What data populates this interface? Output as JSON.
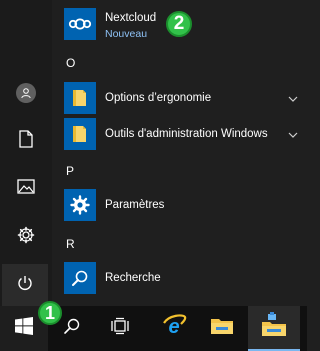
{
  "start_menu": {
    "recent_app": {
      "name": "Nextcloud",
      "subtitle": "Nouveau",
      "icon": "nextcloud-icon"
    },
    "groups": [
      {
        "letter": "O",
        "items": [
          {
            "label": "Options d’ergonomie",
            "icon": "folder-icon",
            "expandable": true
          },
          {
            "label": "Outils d'administration Windows",
            "icon": "folder-icon",
            "expandable": true
          }
        ]
      },
      {
        "letter": "P",
        "items": [
          {
            "label": "Paramètres",
            "icon": "gear-icon",
            "expandable": false
          }
        ]
      },
      {
        "letter": "R",
        "items": [
          {
            "label": "Recherche",
            "icon": "search-icon",
            "expandable": false
          }
        ]
      }
    ]
  },
  "rail": {
    "items": [
      "user-avatar-icon",
      "documents-icon",
      "pictures-icon",
      "settings-icon",
      "power-icon"
    ]
  },
  "taskbar": {
    "items": [
      "windows-start-icon",
      "search-icon",
      "task-view-icon",
      "internet-explorer-icon",
      "file-explorer-icon",
      "file-manager-app-icon"
    ]
  },
  "annotations": {
    "badge_1": "1",
    "badge_2": "2"
  },
  "colors": {
    "menu_bg": "#1f1f1f",
    "rail_bg": "#1b1b1b",
    "taskbar_bg": "#101010",
    "tile_blue": "#0063b1",
    "accent_subtitle": "#8ec1f5",
    "badge_green": "#32c14a"
  }
}
